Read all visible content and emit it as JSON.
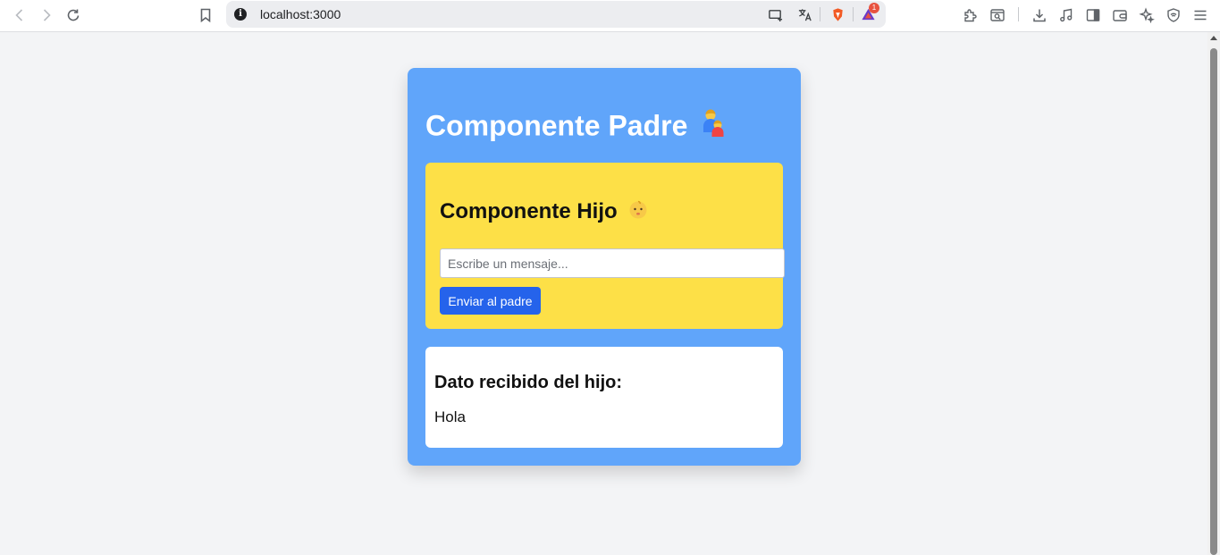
{
  "browser": {
    "url": "localhost:3000",
    "notification_count": "1",
    "icons": [
      "back-icon",
      "forward-icon",
      "reload-icon",
      "bookmark-icon",
      "site-info-icon",
      "cast-icon",
      "translate-icon",
      "brave-shields-icon",
      "brave-rewards-icon",
      "extensions-icon",
      "tab-search-icon",
      "downloads-icon",
      "media-icon",
      "sidebar-icon",
      "wallet-icon",
      "leo-ai-icon",
      "vpn-icon",
      "menu-icon"
    ]
  },
  "parent": {
    "title": "Componente Padre",
    "title_emoji": "family-man-boy-emoji",
    "background": "#60a5fa"
  },
  "child": {
    "title": "Componente Hijo",
    "title_emoji": "baby-emoji",
    "background": "#fde047",
    "input_placeholder": "Escribe un mensaje...",
    "input_value": "",
    "button_label": "Enviar al padre",
    "button_color": "#2563eb"
  },
  "result": {
    "title": "Dato recibido del hijo:",
    "value": "Hola"
  }
}
